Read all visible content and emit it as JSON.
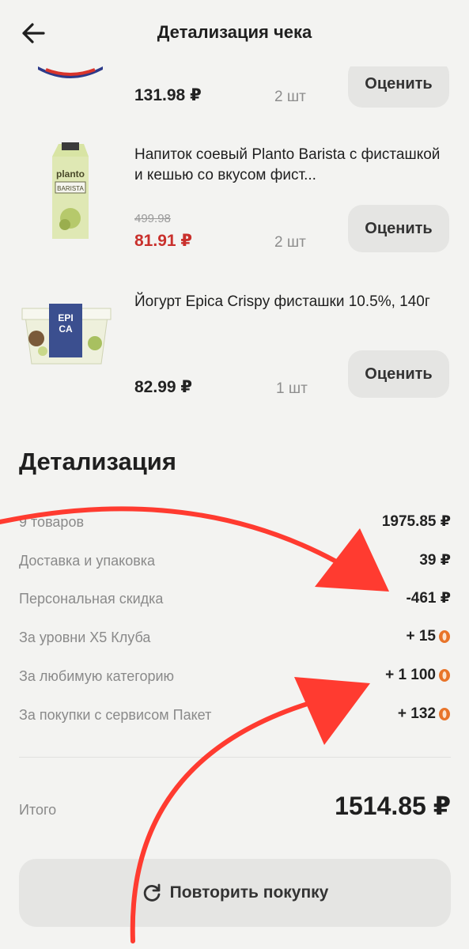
{
  "header": {
    "title": "Детализация чека",
    "back_icon": "arrow-left-icon"
  },
  "items": [
    {
      "title": "",
      "price": "131.98 ₽",
      "old_price": "",
      "qty": "2 шт",
      "rate_label": "Оценить"
    },
    {
      "title": "Напиток соевый Planto Barista с фисташкой и кешью со вкусом фист...",
      "price": "81.91 ₽",
      "old_price": "499.98",
      "qty": "2 шт",
      "rate_label": "Оценить"
    },
    {
      "title": "Йогурт Epica Crispy фисташки 10.5%, 140г",
      "price": "82.99 ₽",
      "old_price": "",
      "qty": "1 шт",
      "rate_label": "Оценить"
    }
  ],
  "details": {
    "title": "Детализация",
    "rows": [
      {
        "label": "9 товаров",
        "value": "1975.85 ₽"
      },
      {
        "label": "Доставка и упаковка",
        "value": "39 ₽"
      },
      {
        "label": "Персональная скидка",
        "value": "-461 ₽"
      },
      {
        "label": "За уровни X5 Клуба",
        "value": "+ 15",
        "icon": "bonus-coin-icon"
      },
      {
        "label": "За любимую категорию",
        "value": "+ 1 100",
        "icon": "bonus-coin-icon"
      },
      {
        "label": "За покупки с сервисом Пакет",
        "value": "+ 132",
        "icon": "bonus-coin-icon"
      }
    ]
  },
  "total": {
    "label": "Итого",
    "value": "1514.85 ₽"
  },
  "repeat_button": {
    "label": "Повторить покупку",
    "icon": "refresh-icon"
  },
  "colors": {
    "sale_price": "#c9302c",
    "coin": "#e8742a",
    "annotation": "#ff3b30"
  }
}
